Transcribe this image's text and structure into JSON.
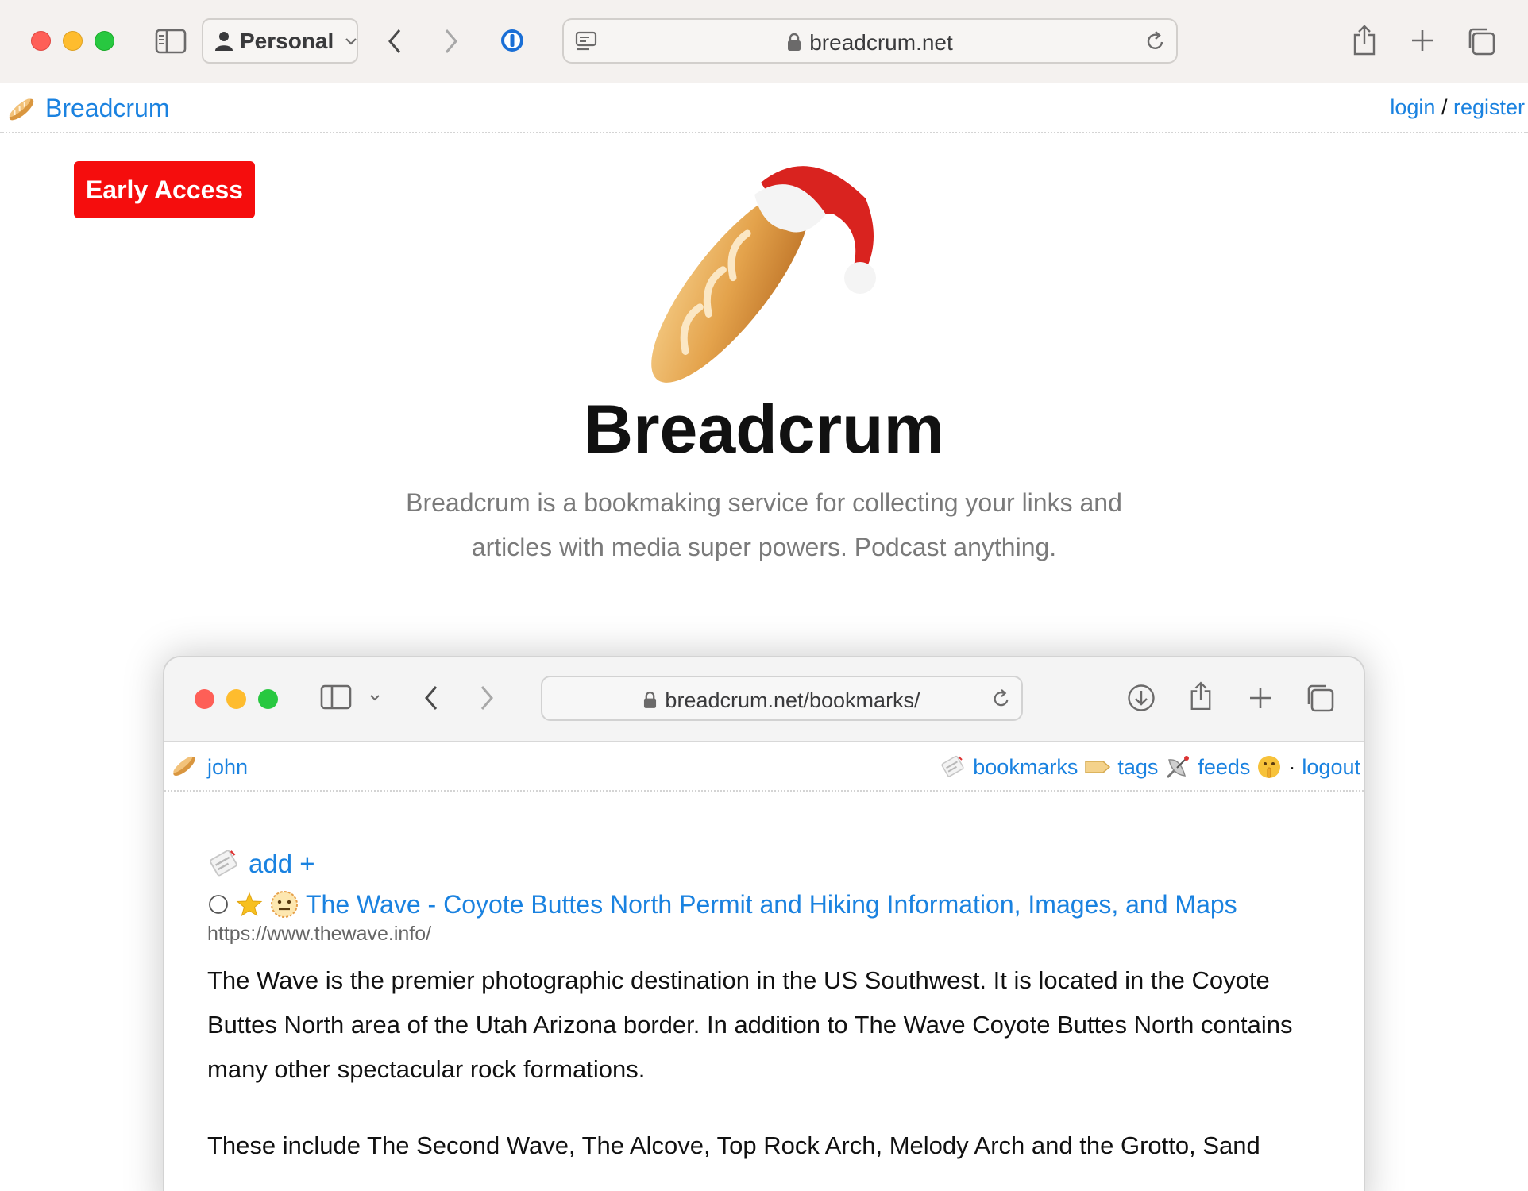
{
  "browser": {
    "profile_label": "Personal",
    "address": "breadcrum.net"
  },
  "site": {
    "brand": "Breadcrum",
    "login": "login",
    "separator": "/",
    "register": "register",
    "early_access": "Early Access",
    "hero_title": "Breadcrum",
    "hero_subtitle": "Breadcrum is a bookmaking service for collecting your links and articles with media super powers. Podcast anything."
  },
  "screenshot": {
    "address": "breadcrum.net/bookmarks/",
    "user": "john",
    "nav": {
      "bookmarks": "bookmarks",
      "tags": "tags",
      "feeds": "feeds",
      "dot": "·",
      "logout": "logout"
    },
    "add_label": "add +",
    "bookmark": {
      "title": "The Wave - Coyote Buttes North Permit and Hiking Information, Images, and Maps",
      "url": "https://www.thewave.info/",
      "description": "The Wave is the premier photographic destination in the US Southwest. It is located in the Coyote Buttes North area of the Utah Arizona border. In addition to The Wave Coyote Buttes North contains many other spectacular rock formations.",
      "description_2": "These include The Second Wave, The Alcove, Top Rock Arch, Melody Arch and the Grotto, Sand"
    }
  },
  "colors": {
    "link": "#1a82e0",
    "early_access_bg": "#f50d0d",
    "traffic_red": "#fe5f57",
    "traffic_yellow": "#febc2e",
    "traffic_green": "#28c840"
  },
  "icons": [
    "sidebar-icon",
    "person-icon",
    "chevron-down-icon",
    "back-icon",
    "forward-icon",
    "password-manager-icon",
    "reader-icon",
    "lock-icon",
    "reload-icon",
    "share-icon",
    "new-tab-icon",
    "tabs-overview-icon",
    "baguette-icon",
    "santa-hat-icon",
    "bookmark-tag-icon",
    "label-icon",
    "satellite-icon",
    "shush-face-icon",
    "star-icon",
    "neutral-face-icon",
    "download-icon"
  ]
}
